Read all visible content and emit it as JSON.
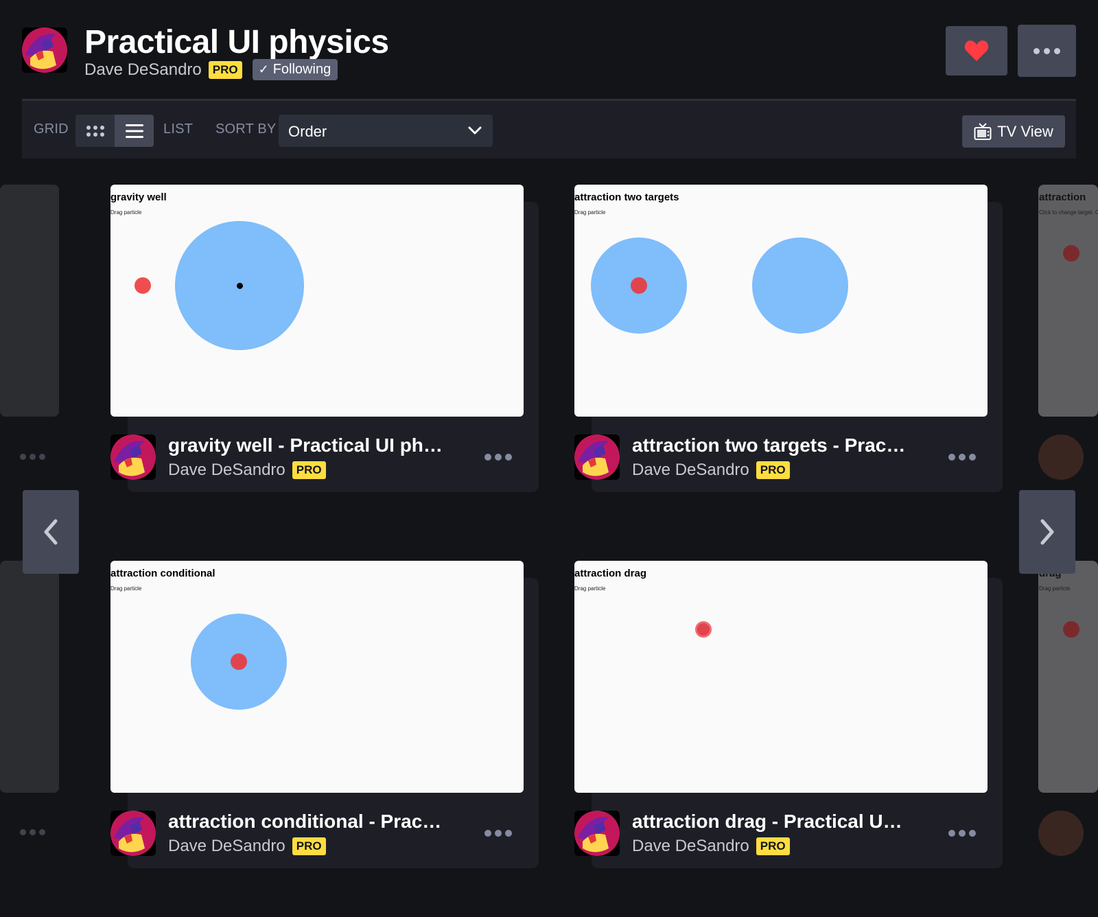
{
  "collection": {
    "title": "Practical UI physics",
    "author": "Dave DeSandro",
    "pro_badge": "PRO",
    "following_label": "Following"
  },
  "toolbar": {
    "grid_label": "GRID",
    "list_label": "LIST",
    "sort_by_label": "SORT BY",
    "sort_value": "Order",
    "tv_view_label": "TV View"
  },
  "cards": [
    {
      "preview_title": "gravity well",
      "preview_subtitle": "Drag particle",
      "title": "gravity well - Practical UI phy...",
      "author": "Dave DeSandro",
      "badge": "PRO"
    },
    {
      "preview_title": "attraction two targets",
      "preview_subtitle": "Drag particle",
      "title": "attraction two targets - Practi...",
      "author": "Dave DeSandro",
      "badge": "PRO"
    },
    {
      "preview_title": "attraction conditional",
      "preview_subtitle": "Drag particle",
      "title": "attraction conditional - Practi...",
      "author": "Dave DeSandro",
      "badge": "PRO"
    },
    {
      "preview_title": "attraction drag",
      "preview_subtitle": "Drag particle",
      "title": "attraction drag - Practical UI p...",
      "author": "Dave DeSandro",
      "badge": "PRO"
    }
  ],
  "peek": {
    "top_title": "attraction",
    "top_subtitle": "Click to change target. Cl",
    "bottom_title": "drag",
    "bottom_subtitle": "Drag particle"
  },
  "colors": {
    "background": "#131417",
    "toolbar": "#1e1f26",
    "button": "#444857",
    "pro_badge": "#ffdd40",
    "heart": "#ff3c41",
    "particle": "#f04e4e",
    "well": "#7fbdfb"
  },
  "icons": {
    "heart": "heart-icon",
    "more": "ellipsis-icon",
    "grid": "grid-icon",
    "list": "list-icon",
    "chevron": "chevron-down-icon",
    "tv": "tv-icon",
    "prev": "chevron-left-icon",
    "next": "chevron-right-icon",
    "check": "check-icon"
  }
}
